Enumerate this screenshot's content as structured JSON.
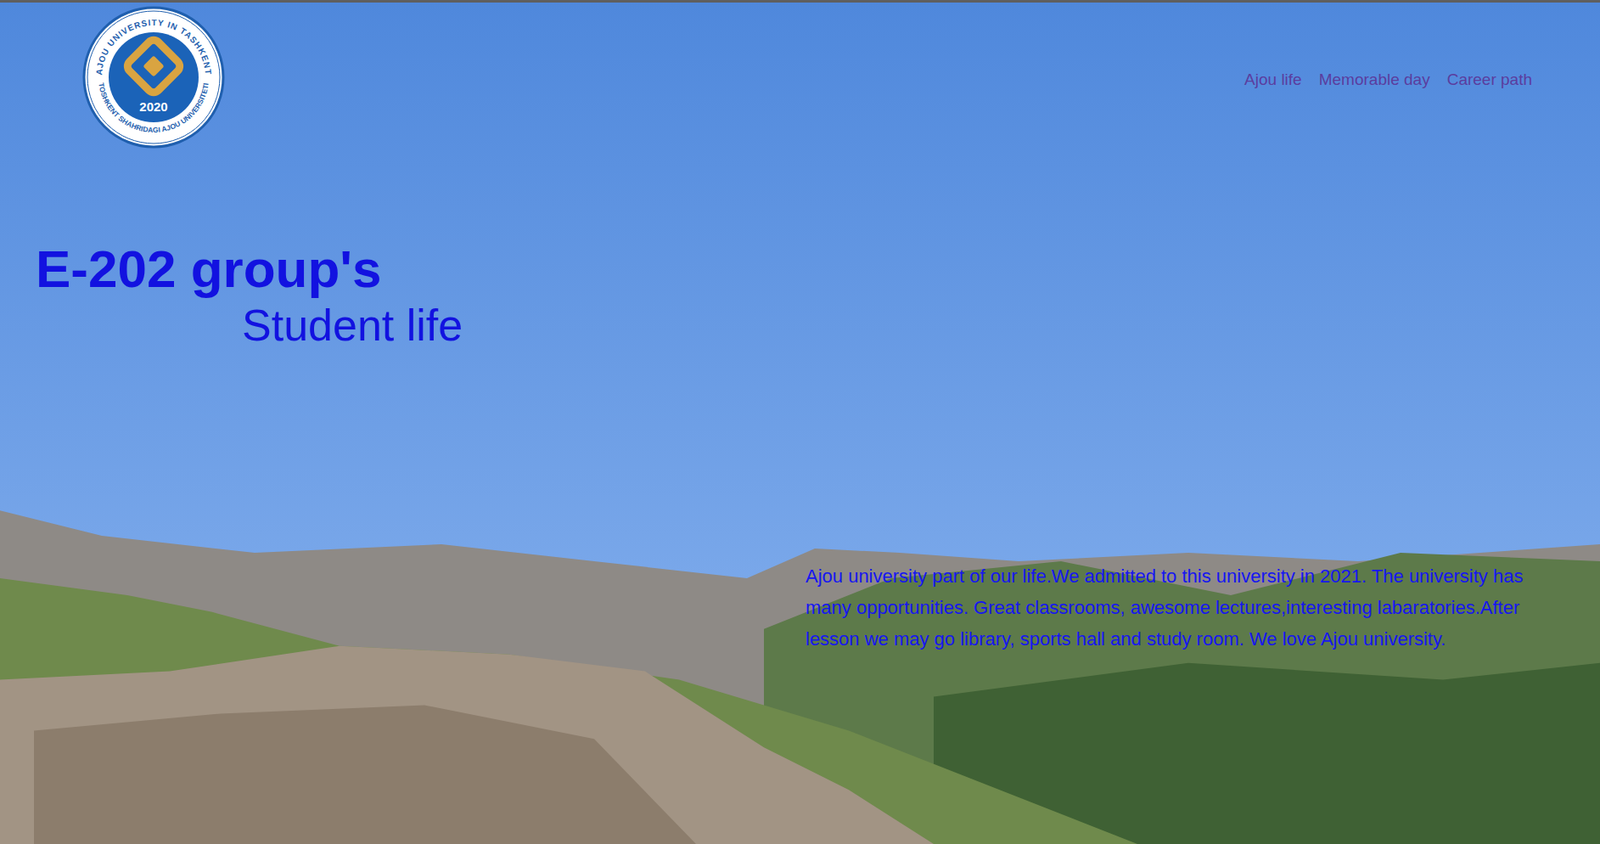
{
  "logo": {
    "ring_top": "AJOU UNIVERSITY IN TASHKENT",
    "ring_bottom": "TOSHKENT SHAHRIDAGI AJOU UNIVERSITETI",
    "year": "2020"
  },
  "nav": [
    {
      "label": "Ajou life"
    },
    {
      "label": "Memorable day"
    },
    {
      "label": "Career path"
    }
  ],
  "hero": {
    "title": "E-202 group's",
    "subtitle": "Student life",
    "text": "Ajou university part of our life.We admitted to this university in 2021. The university has many opportunities. Great classrooms, awesome lectures,interesting labaratories.After lesson we may go library, sports hall and study room. We love Ajou university."
  }
}
